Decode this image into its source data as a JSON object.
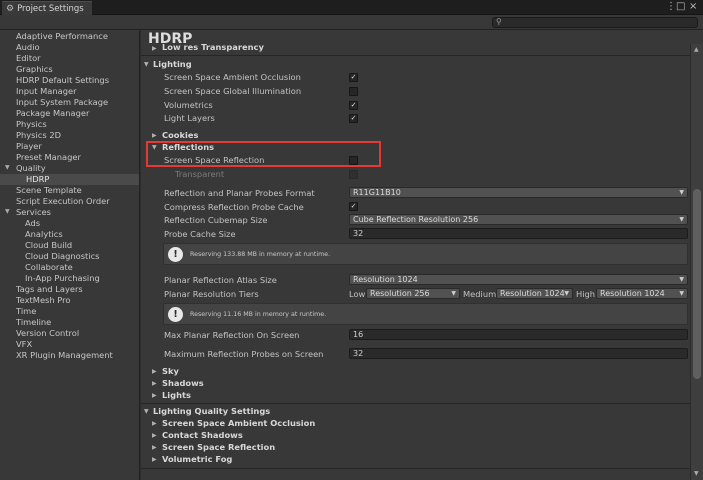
{
  "window": {
    "tab_title": "Project Settings",
    "menu_glyph": "⋮",
    "maximize_glyph": "□",
    "close_glyph": "×",
    "search_placeholder": ""
  },
  "sidebar": {
    "items": [
      {
        "label": "Adaptive Performance"
      },
      {
        "label": "Audio"
      },
      {
        "label": "Editor"
      },
      {
        "label": "Graphics"
      },
      {
        "label": "HDRP Default Settings"
      },
      {
        "label": "Input Manager"
      },
      {
        "label": "Input System Package"
      },
      {
        "label": "Package Manager"
      },
      {
        "label": "Physics"
      },
      {
        "label": "Physics 2D"
      },
      {
        "label": "Player"
      },
      {
        "label": "Preset Manager"
      },
      {
        "label": "Quality"
      },
      {
        "label": "HDRP"
      },
      {
        "label": "Scene Template"
      },
      {
        "label": "Script Execution Order"
      },
      {
        "label": "Services"
      },
      {
        "label": "Ads"
      },
      {
        "label": "Analytics"
      },
      {
        "label": "Cloud Build"
      },
      {
        "label": "Cloud Diagnostics"
      },
      {
        "label": "Collaborate"
      },
      {
        "label": "In-App Purchasing"
      },
      {
        "label": "Tags and Layers"
      },
      {
        "label": "TextMesh Pro"
      },
      {
        "label": "Time"
      },
      {
        "label": "Timeline"
      },
      {
        "label": "Version Control"
      },
      {
        "label": "VFX"
      },
      {
        "label": "XR Plugin Management"
      }
    ],
    "selected": "HDRP"
  },
  "main": {
    "title": "HDRP",
    "lowres_label": "Low res Transparency",
    "lighting": {
      "header": "Lighting",
      "ssao": {
        "label": "Screen Space Ambient Occlusion",
        "checked": true
      },
      "ssgi": {
        "label": "Screen Space Global Illumination",
        "checked": false
      },
      "volumetrics": {
        "label": "Volumetrics",
        "checked": true
      },
      "light_layers": {
        "label": "Light Layers",
        "checked": true
      }
    },
    "cookies": "Cookies",
    "reflections": {
      "header": "Reflections",
      "ssr": {
        "label": "Screen Space Reflection",
        "checked": false
      },
      "transparent": {
        "label": "Transparent"
      },
      "probes_format": {
        "label": "Reflection and Planar Probes Format",
        "value": "R11G11B10"
      },
      "compress_cache": {
        "label": "Compress Reflection Probe Cache",
        "checked": true
      },
      "cubemap_size": {
        "label": "Reflection Cubemap Size",
        "value": "Cube Reflection Resolution 256"
      },
      "probe_cache_size": {
        "label": "Probe Cache Size",
        "value": "32"
      },
      "help1": "Reserving 133.88 MB in memory at runtime.",
      "atlas_size": {
        "label": "Planar Reflection Atlas Size",
        "value": "Resolution 1024"
      },
      "tiers": {
        "label": "Planar Resolution Tiers",
        "low_label": "Low",
        "low": "Resolution 256",
        "medium_label": "Medium",
        "medium": "Resolution 1024",
        "high_label": "High",
        "high": "Resolution 1024"
      },
      "help2": "Reserving 11.16 MB in memory at runtime.",
      "max_planar": {
        "label": "Max Planar Reflection On Screen",
        "value": "16"
      },
      "max_probes": {
        "label": "Maximum Reflection Probes on Screen",
        "value": "32"
      }
    },
    "sky": "Sky",
    "shadows": "Shadows",
    "lights": "Lights",
    "quality": {
      "header": "Lighting Quality Settings",
      "items": [
        {
          "label": "Screen Space Ambient Occlusion"
        },
        {
          "label": "Contact Shadows"
        },
        {
          "label": "Screen Space Reflection"
        },
        {
          "label": "Volumetric Fog"
        }
      ]
    }
  }
}
